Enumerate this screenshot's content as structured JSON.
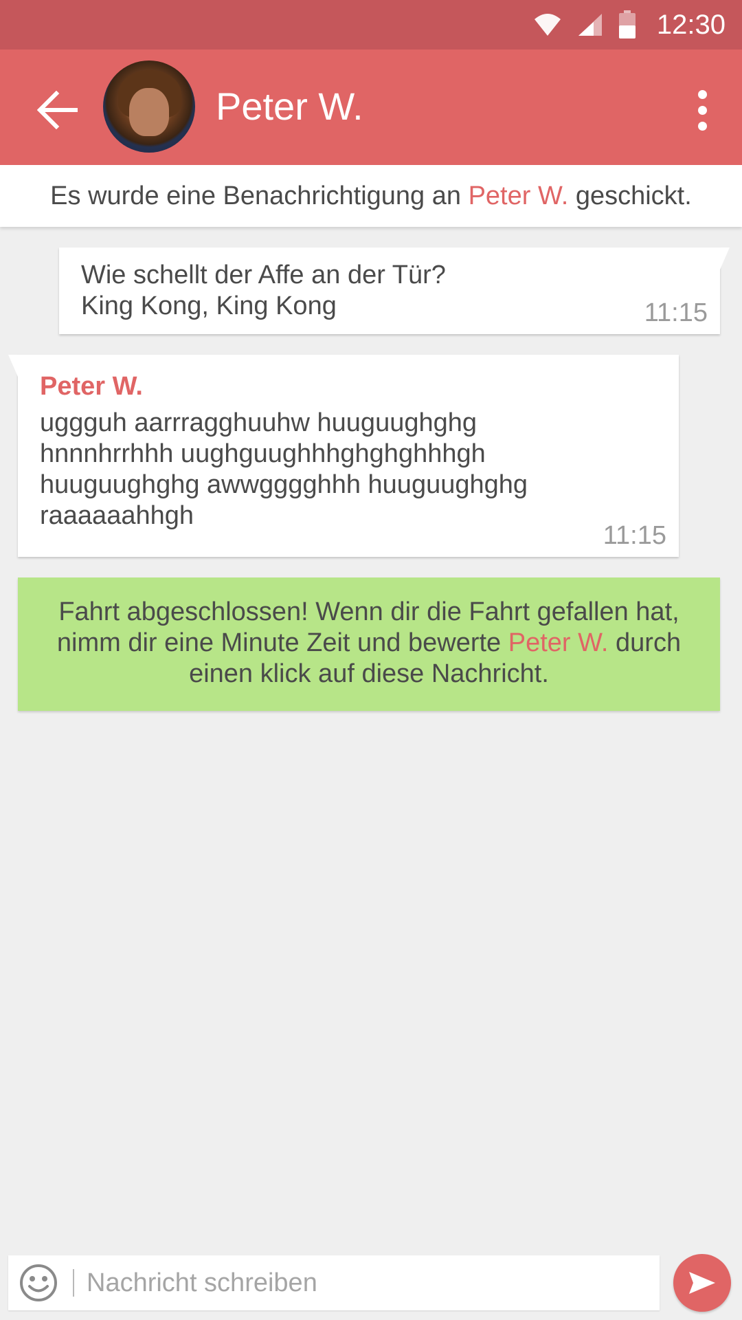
{
  "status_bar": {
    "time": "12:30"
  },
  "app_bar": {
    "contact_name": "Peter W."
  },
  "notice": {
    "before": "Es wurde eine Benachrichtigung an ",
    "name": "Peter W.",
    "after": " geschickt."
  },
  "messages": [
    {
      "direction": "outgoing",
      "lines": [
        "Wie schellt der Affe an der Tür?",
        "King Kong, King Kong"
      ],
      "time": "11:15"
    },
    {
      "direction": "incoming",
      "sender": "Peter W.",
      "lines": [
        "uggguh aarrragghuuhw huuguughghg",
        "hnnnhrrhhh uughguughhhghghghhhgh",
        "huuguughghg awwgggghhh huuguughghg",
        "raaaaaahhgh"
      ],
      "time": "11:15"
    }
  ],
  "rating_prompt": {
    "line1": "Fahrt abgeschlossen! Wenn dir die Fahrt gefallen hat,",
    "line2_before": "nimm dir eine Minute Zeit und bewerte ",
    "name": "Peter W.",
    "line2_after": " durch",
    "line3": "einen klick auf diese Nachricht."
  },
  "composer": {
    "placeholder": "Nachricht schreiben",
    "value": ""
  },
  "icons": {
    "back": "arrow-left-icon",
    "menu": "more-vert-icon",
    "wifi": "wifi-icon",
    "signal": "signal-icon",
    "battery": "battery-icon",
    "emoji": "emoji-icon",
    "send": "send-icon"
  },
  "colors": {
    "accent": "#e06565",
    "status_bar": "#c5575b",
    "rating_bg": "#b7e588",
    "background": "#efefef"
  }
}
